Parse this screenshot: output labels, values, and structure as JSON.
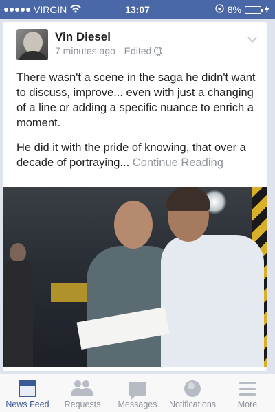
{
  "status_bar": {
    "carrier": "VIRGIN",
    "time": "13:07",
    "battery": "8%",
    "battery_level": 0.08
  },
  "post": {
    "author": "Vin Diesel",
    "timestamp": "7 minutes ago",
    "separator": "·",
    "edited": "Edited",
    "paragraph1": "There wasn't a scene in the saga he didn't want to discuss, improve... even with just a changing of a line or adding a specific nuance to enrich a moment.",
    "paragraph2": "He did it with the pride of knowing, that over a decade of portraying...",
    "continue_link": "Continue Reading",
    "icons": {
      "avatar": "avatar-image",
      "privacy": "globe-icon",
      "menu": "chevron-down-icon",
      "photo": "post-photo"
    }
  },
  "tabbar": {
    "items": [
      {
        "label": "News Feed",
        "icon": "news-feed-icon",
        "active": true
      },
      {
        "label": "Requests",
        "icon": "friend-requests-icon",
        "active": false
      },
      {
        "label": "Messages",
        "icon": "messages-icon",
        "active": false
      },
      {
        "label": "Notifications",
        "icon": "globe-notifications-icon",
        "active": false
      },
      {
        "label": "More",
        "icon": "hamburger-icon",
        "active": false
      }
    ]
  },
  "colors": {
    "status_bar": "#4a67a8",
    "brand": "#3b5998",
    "muted": "#90949c"
  }
}
